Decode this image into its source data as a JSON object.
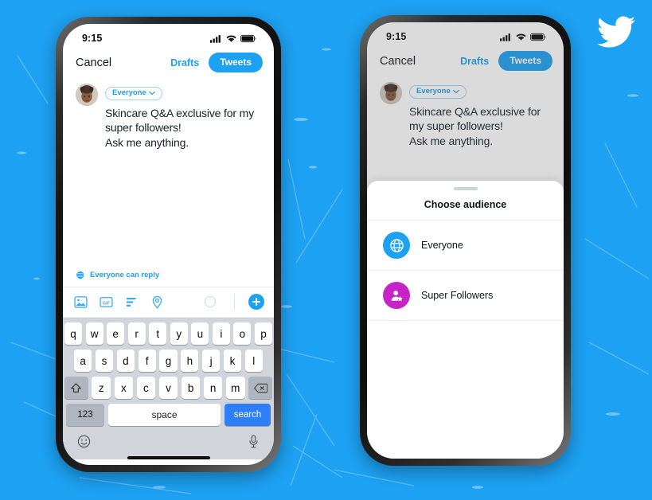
{
  "background": {
    "color": "#1DA1F2",
    "texture": "scratched-paint"
  },
  "brand": {
    "logo": "twitter-bird-icon",
    "logo_color": "#FFFFFF",
    "accent": "#1DA1F2"
  },
  "phones": [
    {
      "id": "compose-keyboard",
      "status_bar": {
        "time": "9:15",
        "icons": [
          "cellular-signal-icon",
          "wifi-icon",
          "battery-icon"
        ]
      },
      "navbar": {
        "cancel_label": "Cancel",
        "drafts_label": "Drafts",
        "tweets_label": "Tweets"
      },
      "composer": {
        "avatar": "user-avatar",
        "audience_chip": {
          "label": "Everyone",
          "chevron": "chevron-down-icon"
        },
        "tweet_text": "Skincare Q&A exclusive for my super followers!\nAsk me anything."
      },
      "reply_notice": {
        "icon": "globe-icon",
        "label": "Everyone can reply"
      },
      "toolbar": {
        "items": [
          "image-icon",
          "gif-icon",
          "poll-icon",
          "location-icon"
        ],
        "char_counter": "char-count-circle",
        "add_label": "plus-icon"
      },
      "keyboard": {
        "row1": [
          "q",
          "w",
          "e",
          "r",
          "t",
          "y",
          "u",
          "i",
          "o",
          "p"
        ],
        "row2": [
          "a",
          "s",
          "d",
          "f",
          "g",
          "h",
          "j",
          "k",
          "l"
        ],
        "row3_left": "shift-icon",
        "row3": [
          "z",
          "x",
          "c",
          "v",
          "b",
          "n",
          "m"
        ],
        "row3_right": "backspace-icon",
        "numbers_label": "123",
        "space_label": "space",
        "return_label": "search",
        "emoji_label": "emoji-icon",
        "mic_label": "microphone-icon"
      },
      "home_indicator": true
    },
    {
      "id": "choose-audience-sheet",
      "status_bar": {
        "time": "9:15",
        "icons": [
          "cellular-signal-icon",
          "wifi-icon",
          "battery-icon"
        ]
      },
      "navbar": {
        "cancel_label": "Cancel",
        "drafts_label": "Drafts",
        "tweets_label": "Tweets"
      },
      "composer": {
        "avatar": "user-avatar",
        "audience_chip": {
          "label": "Everyone",
          "chevron": "chevron-down-icon"
        },
        "tweet_text": "Skincare Q&A exclusive for my super followers!\nAsk me anything."
      },
      "sheet": {
        "grabber": true,
        "title": "Choose audience",
        "options": [
          {
            "label": "Everyone",
            "icon": "globe-icon",
            "icon_color": "#1DA1F2"
          },
          {
            "label": "Super Followers",
            "icon": "super-follower-icon",
            "icon_color": "#C724C7"
          }
        ]
      }
    }
  ]
}
